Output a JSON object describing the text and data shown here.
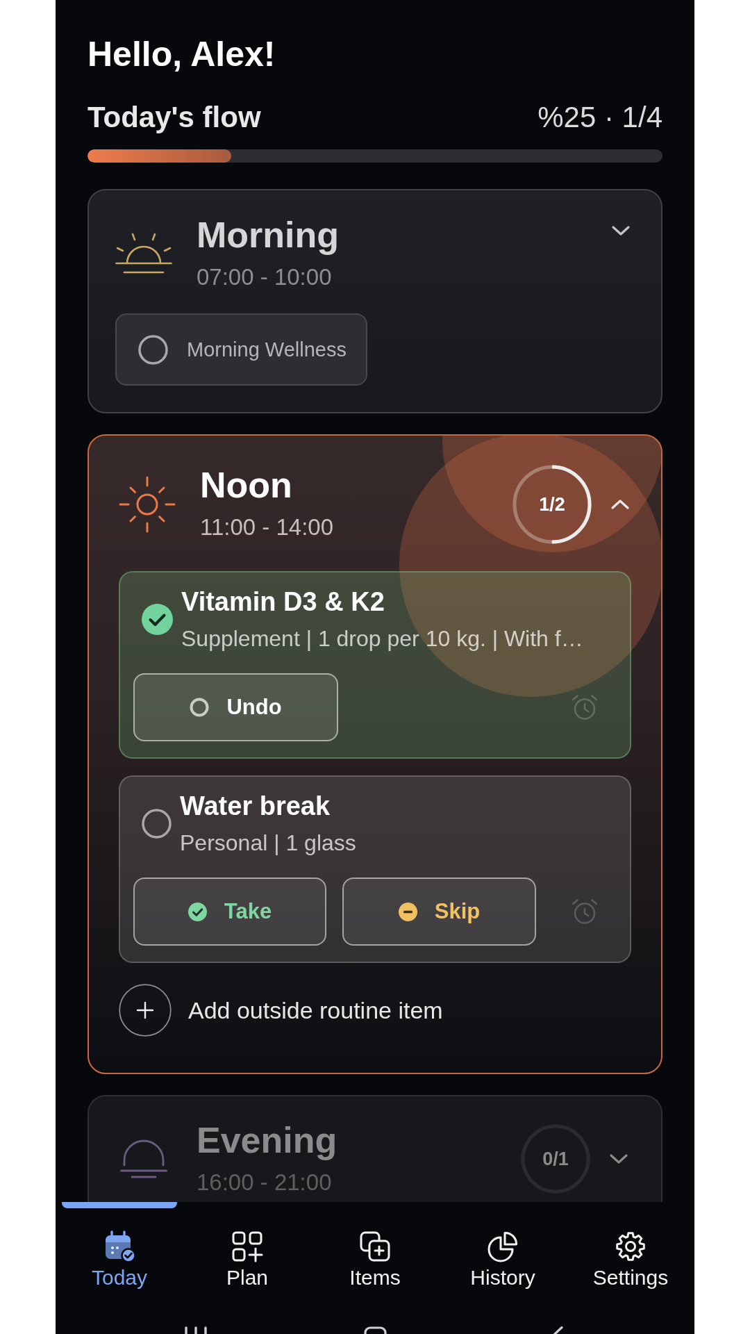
{
  "greeting": "Hello, Alex!",
  "flow": {
    "title": "Today's flow",
    "summary": "%25 · 1/4",
    "level": 0.25
  },
  "periods": [
    {
      "kind": "morning",
      "name": "Morning",
      "time": "07:00 - 10:00",
      "active": false,
      "dimmed": false,
      "expanded": false,
      "items": [
        {
          "name": "Morning Wellness",
          "checked": false
        }
      ]
    },
    {
      "kind": "noon",
      "name": "Noon",
      "time": "11:00 - 14:00",
      "active": true,
      "dimmed": false,
      "expanded": true,
      "progress": {
        "text": "1/2",
        "level": 0.5
      },
      "items": [
        {
          "name": "Vitamin D3 & K2",
          "details": "Supplement | 1 drop per 10 kg. | With f…",
          "checked": true,
          "actions": [
            {
              "kind": "undo",
              "label": "Undo"
            }
          ]
        },
        {
          "name": "Water break",
          "details": "Personal | 1 glass",
          "checked": false,
          "actions": [
            {
              "kind": "take",
              "label": "Take"
            },
            {
              "kind": "skip",
              "label": "Skip"
            }
          ]
        }
      ],
      "add_label": "Add outside routine item"
    },
    {
      "kind": "evening",
      "name": "Evening",
      "time": "16:00 - 21:00",
      "active": false,
      "dimmed": true,
      "expanded": false,
      "progress": {
        "text": "0/1",
        "level": 0
      }
    }
  ],
  "nav": [
    {
      "label": "Today",
      "selected": true
    },
    {
      "label": "Plan",
      "selected": false
    },
    {
      "label": "Items",
      "selected": false
    },
    {
      "label": "History",
      "selected": false
    },
    {
      "label": "Settings",
      "selected": false
    }
  ]
}
